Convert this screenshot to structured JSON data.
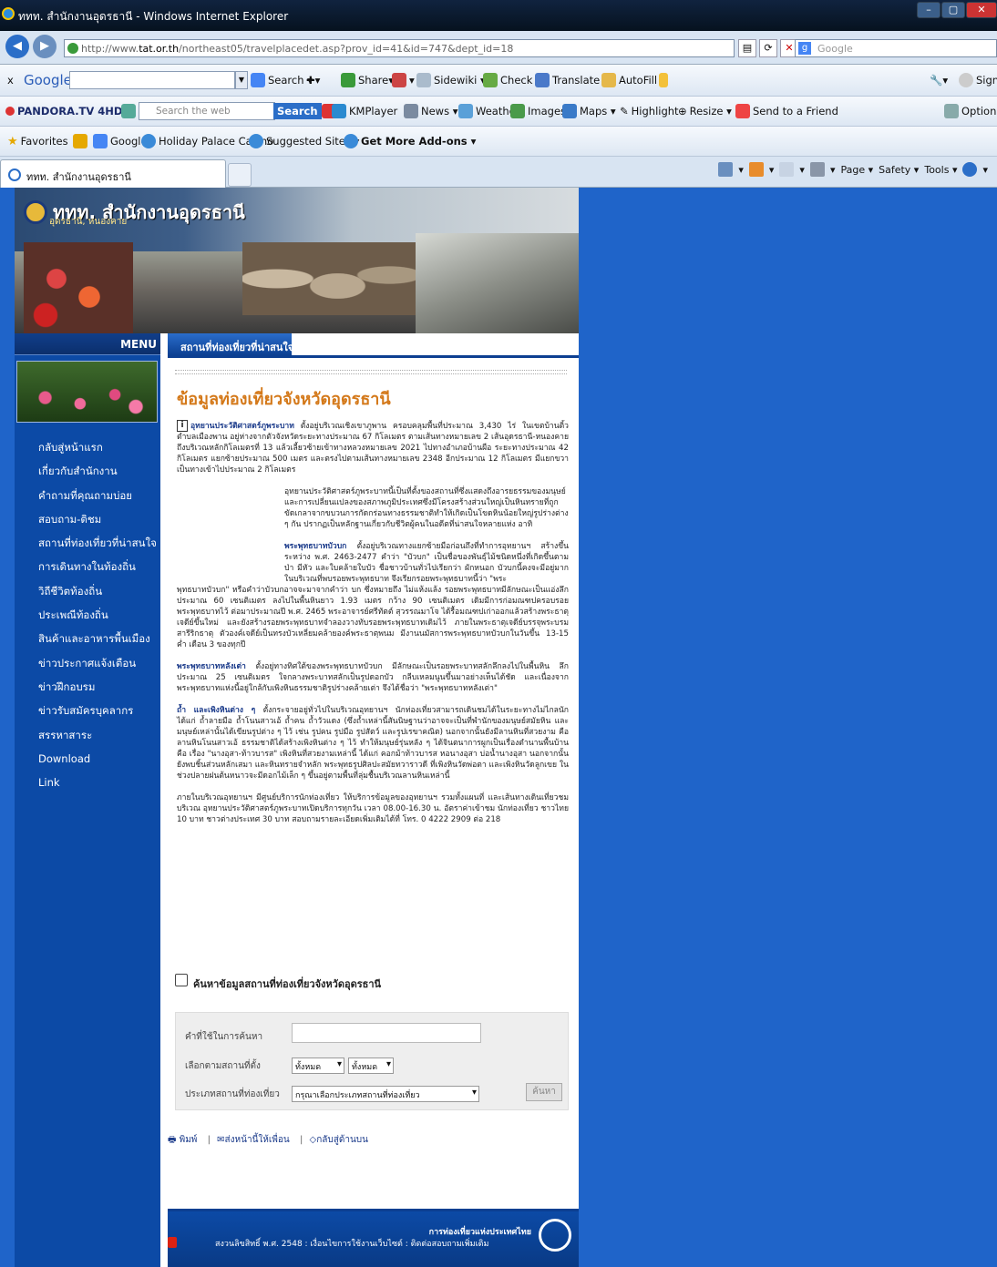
{
  "window": {
    "title": "ททท. สำนักงานอุดรธานี - Windows Internet Explorer",
    "min": "–",
    "max": "▢",
    "close": "✕"
  },
  "address": {
    "url_prefix": "http://www.",
    "url_domain": "tat.or.th",
    "url_rest": "/northeast05/travelplacedet.asp?prov_id=41&id=747&dept_id=18",
    "search_placeholder": "Google",
    "refresh": "⟳",
    "stop": "✕"
  },
  "google_toolbar": {
    "logo": "Google",
    "close": "x",
    "search": "Search",
    "share": "Share",
    "sidewiki": "Sidewiki",
    "check": "Check",
    "translate": "Translate",
    "autofill": "AutoFill",
    "sign_in": "Sign In"
  },
  "pandora_toolbar": {
    "brand": "PANDORA.TV 4HD",
    "search_placeholder": "Search the web",
    "search_btn": "Search",
    "kmplayer": "KMPlayer",
    "news": "News",
    "weather": "Weather",
    "images": "Images",
    "maps": "Maps",
    "highlight": "Highlight",
    "resize": "Resize",
    "send": "Send to a Friend",
    "options": "Options"
  },
  "favorites_bar": {
    "favorites": "Favorites",
    "items": [
      "Google",
      "Holiday Palace Casino",
      "Suggested Sites ▾",
      "Get More Add-ons ▾"
    ]
  },
  "tabbar": {
    "tab_title": "ททท. สำนักงานอุดรธานี",
    "page": "Page ▾",
    "safety": "Safety ▾",
    "tools": "Tools ▾"
  },
  "site": {
    "logo_title": "ททท. สำนักงานอุดรธานี",
    "logo_sub": "อุดรธานี, หนองคาย",
    "menu_head": "MENU",
    "menu": [
      "กลับสู่หน้าแรก",
      "เกี่ยวกับสำนักงาน",
      "คำถามที่คุณถามบ่อย",
      "สอบถาม-ติชม",
      "สถานที่ท่องเที่ยวที่น่าสนใจ",
      "การเดินทางในท้องถิ่น",
      "วิถีชีวิตท้องถิ่น",
      "ประเพณีท้องถิ่น",
      "สินค้าและอาหารพื้นเมือง",
      "ข่าวประกาศแจ้งเตือน",
      "ข่าวฝึกอบรม",
      "ข่าวรับสมัครบุคลากร",
      "สรรหาสาระ",
      "Download",
      "Link"
    ],
    "section_tab": "สถานที่ท่องเที่ยวที่น่าสนใจ",
    "page_title": "ข้อมูลท่องเที่ยวจังหวัดอุดรธานี"
  },
  "article": {
    "p1_title": "อุทยานประวัติศาสตร์ภูพระบาท",
    "p1": "ตั้งอยู่บริเวณเชิงเขาภูพาน ครอบคลุมพื้นที่ประมาณ 3,430 ไร่ ในเขตบ้านติ้ว ตำบลเมืองพาน อยู่ห่างจากตัวจังหวัดระยะทางประมาณ 67 กิโลเมตร ตามเส้นทางหมายเลข 2 เส้นอุดรธานี-หนองคาย ถึงบริเวณหลักกิโลเมตรที่ 13 แล้วเลี้ยวซ้ายเข้าทางหลวงหมายเลข 2021 ไปทางอำเภอบ้านผือ ระยะทางประมาณ 42 กิโลเมตร แยกซ้ายประมาณ 500 เมตร และตรงไปตามเส้นทางหมายเลข 2348 อีกประมาณ 12 กิโลเมตร มีแยกขวาเป็นทางเข้าไปประมาณ 2 กิโลเมตร",
    "p2": "อุทยานประวัติศาสตร์ภูพระบาทนี้เป็นที่ตั้งของสถานที่ซึ่งแสดงถึงอารยธรรมของมนุษย์ และการเปลี่ยนแปลงของสภาพภูมิประเทศซึ่งมีโครงสร้างส่วนใหญ่เป็นหินทรายที่ถูกขัดเกลาจากขบวนการกัดกร่อนทางธรรมชาติทำให้เกิดเป็นโขดหินน้อยใหญ่รูปร่างต่าง ๆ กัน ปรากฏเป็นหลักฐานเกี่ยวกับชีวิตผู้คนในอดีตที่น่าสนใจหลายแห่ง อาทิ",
    "p3_title": "พระพุทธบาทบัวบก",
    "p3a": "ตั้งอยู่บริเวณทางแยกซ้ายมือก่อนถึงที่ทำการอุทยานฯ สร้างขึ้นระหว่าง พ.ศ. 2463-2477 คำว่า \"บัวบก\" เป็นชื่อของพันธุ์ไม้ชนิดหนึ่งที่เกิดขึ้นตามป่า มีหัว และใบคล้ายใบบัว ชื่อชาวบ้านทั่วไปเรียกว่า ผักหนอก บัวบกนี้คงจะมีอยู่มากในบริเวณที่พบรอยพระพุทธบาท จึงเรียกรอยพระพุทธบาทนี้ว่า \"พระ",
    "p3b": "พุทธบาทบัวบก\" หรือคำว่าบัวบกอาจจะมาจากคำว่า บก ซึ่งหมายถึง ไม่แห้งแล้ง รอยพระพุทธบาทมีลักษณะเป็นแอ่งลึกประมาณ 60 เซนติเมตร ลงไปในพื้นหินยาว 1.93 เมตร กว้าง 90 เซนติเมตร เดิมมีการก่อมณฑปครอบรอยพระพุทธบาทไว้ ต่อมาประมาณปี พ.ศ. 2465 พระอาจารย์ศรีทัตต์ สุวรรณมาโจ ได้รื้อมณฑปเก่าออกแล้วสร้างพระธาตุเจดีย์ขึ้นใหม่ และยังสร้างรอยพระพุทธบาทจำลองวางทับรอยพระพุทธบาทเดิมไว้ ภายในพระธาตุเจดีย์บรรจุพระบรมสารีริกธาตุ ตัวองค์เจดีย์เป็นทรงบัวเหลี่ยมคล้ายองค์พระธาตุพนม มีงานนมัสการพระพุทธบาทบัวบกในวันขึ้น 13-15 ค่ำ เดือน 3 ของทุกปี",
    "p4_title": "พระพุทธบาทหลังเต่า",
    "p4": "ตั้งอยู่ทางทิศใต้ของพระพุทธบาทบัวบก มีลักษณะเป็นรอยพระบาทสลักลึกลงไปในพื้นหิน ลึกประมาณ 25 เซนติเมตร ใจกลางพระบาทสลักเป็นรูปดอกบัว กลีบเหลมนูนขึ้นมาอย่างเห็นได้ชัด และเนื่องจากพระพุทธบาทแห่งนี้อยู่ใกล้กับเพิงหินธรรมชาติรูปร่างคล้ายเต่า จึงได้ชื่อว่า \"พระพุทธบาทหลังเต่า\"",
    "p5_title": "ถ้ำ และเพิงหินต่าง ๆ",
    "p5": "ตั้งกระจายอยู่ทั่วไปในบริเวณอุทยานฯ นักท่องเที่ยวสามารถเดินชมได้ในระยะทางไม่ไกลนัก ได้แก่ ถ้ำลายมือ ถ้ำโนนสาวเอ้ ถ้ำคน ถ้ำวัวแดง (ซึ่งถ้ำเหล่านี้สันนิษฐานว่าอาจจะเป็นที่พำนักของมนุษย์สมัยหิน และมนุษย์เหล่านั้นได้เขียนรูปต่าง ๆ ไว้ เช่น รูปคน รูปมือ รูปสัตว์ และรูปเรขาคณิต) นอกจากนั้นยังมีลานหินที่สวยงาม คือ ลานหินโนนสาวเอ้ ธรรมชาติได้สร้างเพิงหินต่าง ๆ ไว้ ทำให้มนุษย์รุ่นหลัง ๆ ได้จินตนาการผูกเป็นเรื่องตำนานพื้นบ้าน คือ เรื่อง \"นางอุสา-ท้าวบารส\" เพิงหินที่สวยงามเหล่านี้ ได้แก่ คอกม้าท้าวบารส หอนางอุสา บ่อน้ำนางอุสา นอกจากนั้นยังพบชิ้นส่วนหลักเสมา และหินทรายจำหลัก พระพุทธรูปศิลปะสมัยทวาราวดี ที่เพิงหินวัดพ่อตา และเพิงหินวัดลูกเขย ในช่วงปลายฝนต้นหนาวจะมีดอกไม้เล็ก ๆ ขึ้นอยู่ตามพื้นที่ลุ่มชื้นบริเวณลานหินเหล่านี้",
    "p6": "ภายในบริเวณอุทยานฯ มีศูนย์บริการนักท่องเที่ยว ให้บริการข้อมูลของอุทยานฯ รวมทั้งแผนที่ และเส้นทางเดินเที่ยวชมบริเวณ อุทยานประวัติศาสตร์ภูพระบาทเปิดบริการทุกวัน เวลา 08.00-16.30 น. อัตราค่าเข้าชม นักท่องเที่ยว ชาวไทย 10 บาท ชาวต่างประเทศ 30 บาท สอบถามรายละเอียดเพิ่มเติมได้ที่ โทร. 0 4222 2909 ต่อ 218"
  },
  "search": {
    "title": "ค้นหาข้อมูลสถานที่ท่องเที่ยวจังหวัดอุดรธานี",
    "keyword_label": "คำที่ใช้ในการค้นหา",
    "location_label": "เลือกตามสถานที่ตั้ง",
    "type_label": "ประเภทสถานที่ท่องเที่ยว",
    "select_all_1": "ทั้งหมด",
    "select_all_2": "ทั้งหมด",
    "select_type": "กรุณาเลือกประเภทสถานที่ท่องเที่ยว",
    "button": "ค้นหา"
  },
  "actions": {
    "print": "พิมพ์",
    "send": "ส่งหน้านี้ให้เพื่อน",
    "top": "กลับสู่ด้านบน"
  },
  "footer": {
    "org": "การท่องเที่ยวแห่งประเทศไทย",
    "copyright": "สงวนลิขสิทธิ์ พ.ศ. 2548 : เงื่อนไขการใช้งานเว็บไซต์ : ติดต่อสอบถามเพิ่มเติม"
  }
}
